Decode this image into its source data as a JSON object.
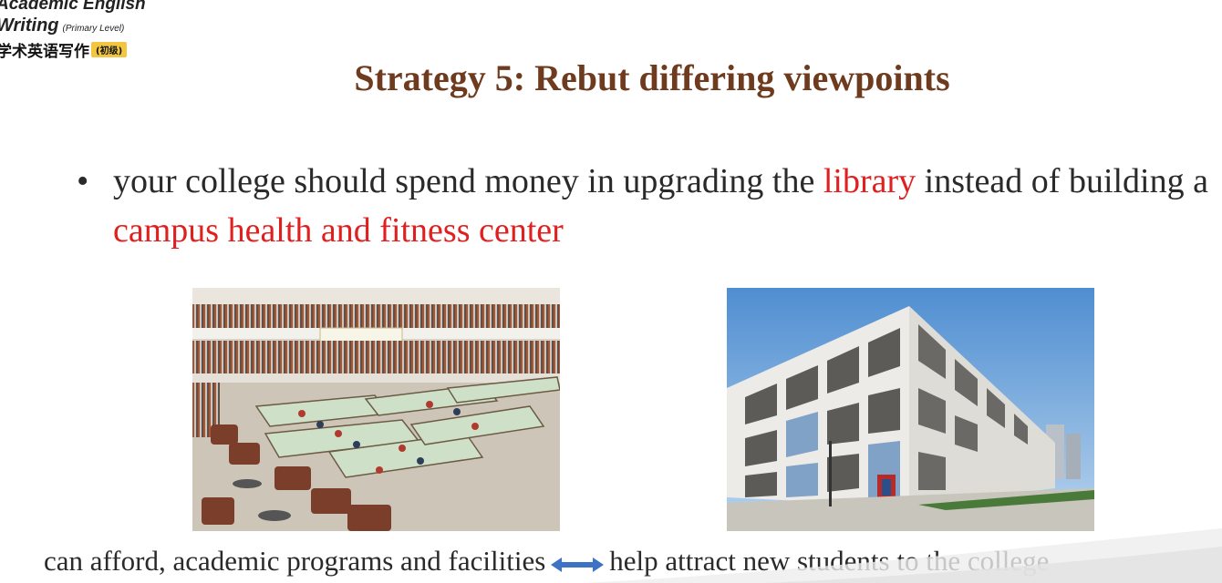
{
  "logo": {
    "line1": "Academic English",
    "line2_main": "Writing",
    "line2_sub": "(Primary Level)",
    "line3_main": "学术英语写作",
    "line3_tag": "(初级)"
  },
  "slide": {
    "title": "Strategy 5: Rebut differing viewpoints",
    "bullet": {
      "part1": "your college should spend money in upgrading the ",
      "highlight1": "library",
      "part2": " instead of building a ",
      "highlight2": "campus health and fitness center"
    },
    "caption": {
      "left": "can afford, academic programs and facilities",
      "right": "help attract new students to the college"
    }
  },
  "icons": {
    "bullet": "bullet-dot-icon",
    "arrow": "double-arrow-icon"
  },
  "colors": {
    "title": "#6e3b1f",
    "highlight": "#e0201f",
    "text": "#2a2a2a",
    "arrow": "#3c73c4",
    "logo_tag": "#f2c640"
  }
}
